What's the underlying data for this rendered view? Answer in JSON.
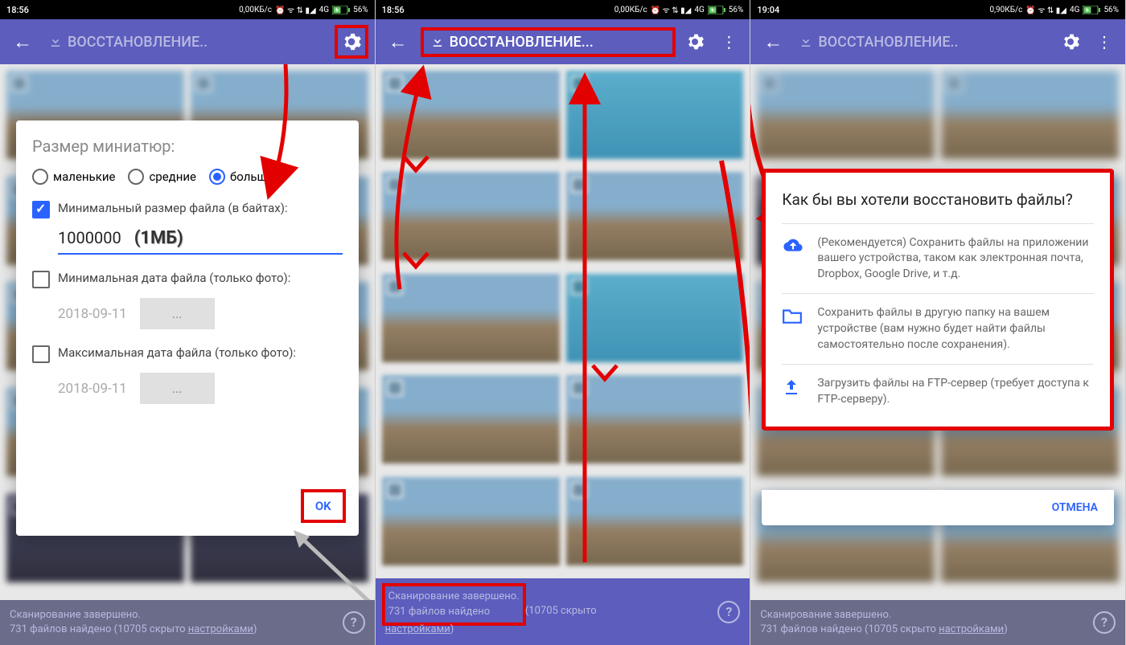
{
  "panel1": {
    "status": {
      "time": "18:56",
      "speed": "0,00КБ/с",
      "net": "4G",
      "battery": "56%"
    },
    "title": "ВОССТАНОВЛЕНИЕ..",
    "dialog": {
      "title": "Размер миниатюр:",
      "radios": {
        "small": "маленькие",
        "medium": "средние",
        "large": "большие"
      },
      "minsize_label": "Минимальный размер файла (в байтах):",
      "minsize_value": "1000000",
      "minsize_hint": "(1МБ)",
      "mindate_label": "Минимальная дата файла (только фото):",
      "mindate_value": "2018-09-11",
      "mindate_btn": "...",
      "maxdate_label": "Максимальная дата файла (только фото):",
      "maxdate_value": "2018-09-11",
      "maxdate_btn": "...",
      "ok": "OK"
    },
    "bottom": {
      "line1": "Сканирование завершено.",
      "line2_a": "731 файлов найдено (10705 скрыто",
      "line2_b": "настройками",
      "line2_c": ")"
    }
  },
  "panel2": {
    "status": {
      "time": "18:56",
      "speed": "0,00КБ/с",
      "net": "4G",
      "battery": "56%"
    },
    "title": "ВОССТАНОВЛЕНИЕ...",
    "bottom": {
      "line1": "Сканирование завершено.",
      "line2_a": "731 файлов найдено",
      "line2_b": " (10705 скрыто",
      "line2_c": "настройками",
      "line2_d": ")"
    }
  },
  "panel3": {
    "status": {
      "time": "19:04",
      "speed": "0,90КБ/с",
      "net": "4G",
      "battery": "56%"
    },
    "title": "ВОССТАНОВЛЕНИЕ..",
    "dialog": {
      "title": "Как бы вы хотели восстановить файлы?",
      "opt1": "(Рекомендуется) Сохранить файлы на приложении вашего устройства, таком как электронная почта, Dropbox, Google Drive, и т.д.",
      "opt2": "Сохранить файлы в другую папку на вашем устройстве (вам нужно будет найти файлы самостоятельно после сохранения).",
      "opt3": "Загрузить файлы на FTP-сервер (требует доступа к FTP-серверу).",
      "cancel": "ОТМЕНА"
    },
    "bottom": {
      "line1": "Сканирование завершено.",
      "line2_a": "731 файлов найдено (10705 скрыто",
      "line2_b": "настройками",
      "line2_c": ")"
    }
  }
}
